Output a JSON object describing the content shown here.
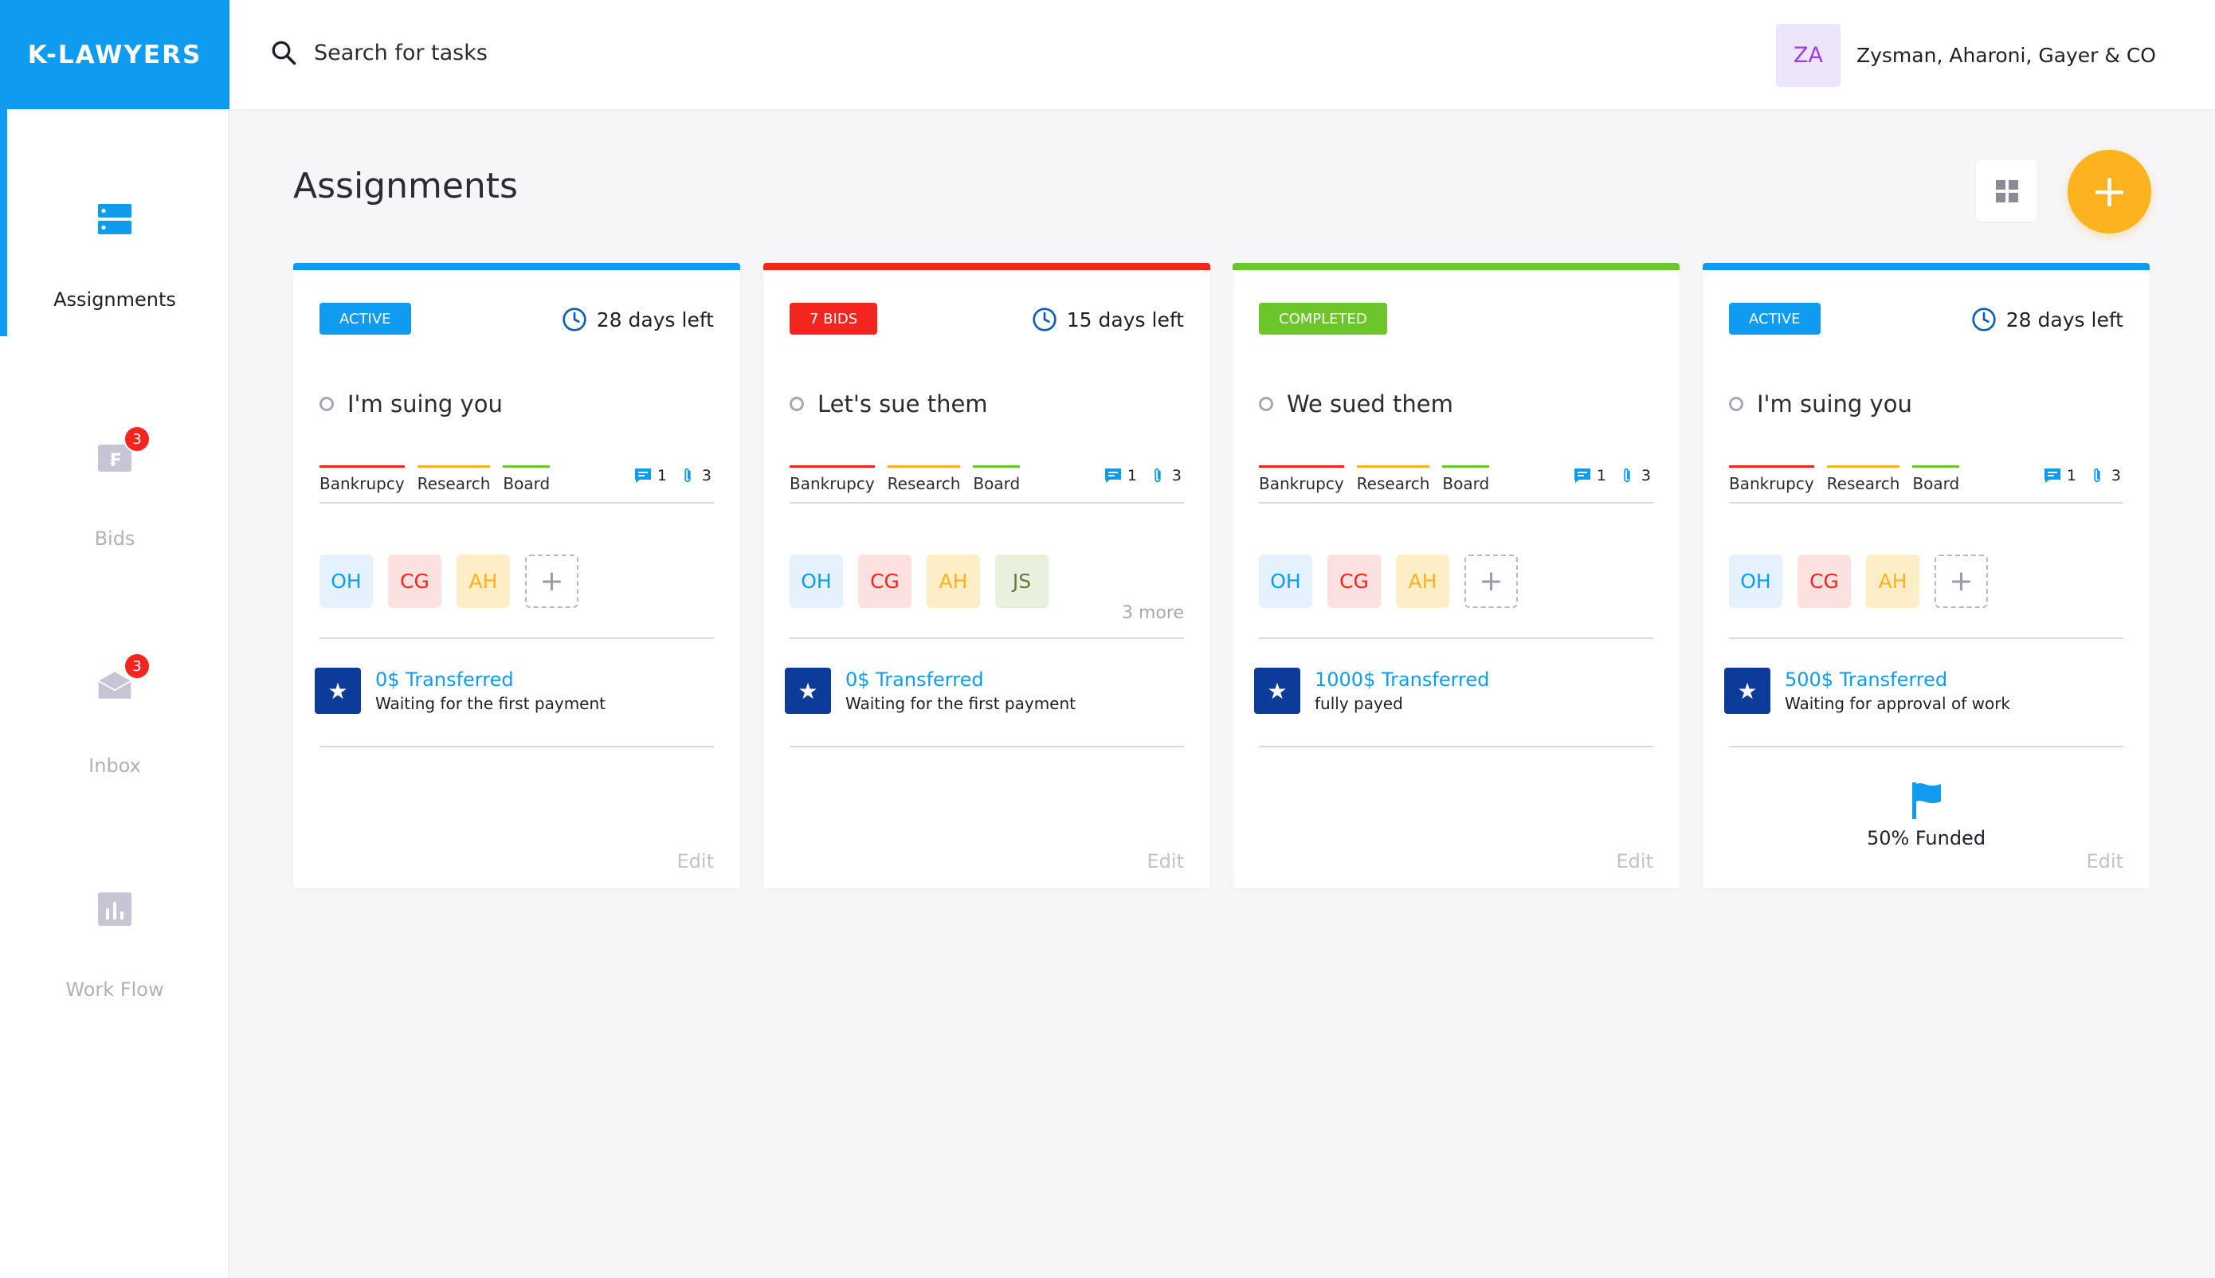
{
  "app": {
    "logo": "K-LAWYERS"
  },
  "search": {
    "placeholder": "Search for tasks"
  },
  "user": {
    "initials": "ZA",
    "name": "Zysman, Aharoni, Gayer & CO"
  },
  "sidebar": {
    "items": [
      {
        "label": "Assignments",
        "icon": "assignments-icon",
        "active": true
      },
      {
        "label": "Bids",
        "icon": "bids-icon",
        "badge": "3"
      },
      {
        "label": "Inbox",
        "icon": "inbox-icon",
        "badge": "3"
      },
      {
        "label": "Work Flow",
        "icon": "workflow-icon"
      }
    ]
  },
  "main": {
    "title": "Assignments",
    "add_label": "+",
    "cards": [
      {
        "status": "ACTIVE",
        "status_color": "#0f9cf0",
        "accent": "#0f9cf0",
        "days": "28 days left",
        "title": "I'm suing you",
        "tags": [
          "Bankrupcy",
          "Research",
          "Board"
        ],
        "comments": "1",
        "attachments": "3",
        "people": [
          "OH",
          "CG",
          "AH"
        ],
        "amount": "0$ Transferred",
        "note": "Waiting for the first payment",
        "edit": "Edit"
      },
      {
        "status": "7 BIDS",
        "status_color": "#f4241e",
        "accent": "#f4241e",
        "days": "15 days left",
        "title": "Let's sue them",
        "tags": [
          "Bankrupcy",
          "Research",
          "Board"
        ],
        "comments": "1",
        "attachments": "3",
        "people": [
          "OH",
          "CG",
          "AH",
          "JS"
        ],
        "more": "3 more",
        "amount": "0$ Transferred",
        "note": "Waiting for the first payment",
        "edit": "Edit"
      },
      {
        "status": "COMPLETED",
        "status_color": "#6cc52a",
        "accent": "#6cc52a",
        "title": "We sued them",
        "tags": [
          "Bankrupcy",
          "Research",
          "Board"
        ],
        "comments": "1",
        "attachments": "3",
        "people": [
          "OH",
          "CG",
          "AH"
        ],
        "amount": "1000$ Transferred",
        "note": "fully payed",
        "edit": "Edit"
      },
      {
        "status": "ACTIVE",
        "status_color": "#0f9cf0",
        "accent": "#0f9cf0",
        "days": "28 days left",
        "title": "I'm suing you",
        "tags": [
          "Bankrupcy",
          "Research",
          "Board"
        ],
        "comments": "1",
        "attachments": "3",
        "people": [
          "OH",
          "CG",
          "AH"
        ],
        "amount": "500$ Transferred",
        "note": "Waiting for approval of work",
        "funded": "50% Funded",
        "funded_fraction": 0.5,
        "edit": "Edit"
      }
    ]
  },
  "colors": {
    "tag_bankrupcy": "#f4241e",
    "tag_research": "#fdb220",
    "tag_board": "#6cc52a",
    "person_OH": "#e5f1fd",
    "person_OH_text": "#0f9cf0",
    "person_CG": "#fde0e0",
    "person_CG_text": "#f4241e",
    "person_AH": "#fdeec8",
    "person_AH_text": "#fdb220",
    "person_JS": "#e9f1de",
    "person_JS_text": "#5e7b3b"
  }
}
